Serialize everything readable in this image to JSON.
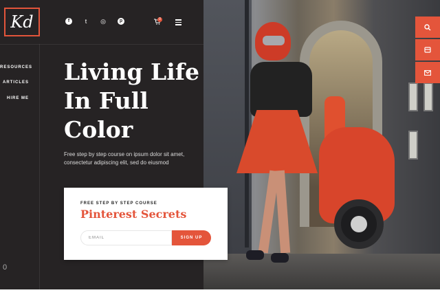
{
  "logo": {
    "text": "Kd"
  },
  "social": [
    {
      "icon": "facebook-icon",
      "glyph": "f"
    },
    {
      "icon": "twitter-icon",
      "glyph": "t"
    },
    {
      "icon": "instagram-icon",
      "glyph": "◎"
    },
    {
      "icon": "pinterest-icon",
      "glyph": "p"
    }
  ],
  "cart": {
    "icon": "cart-icon",
    "badge": "0"
  },
  "nav": {
    "items": [
      "RESOURCES",
      "ARTICLES",
      "HIRE ME"
    ]
  },
  "hero": {
    "title_line1": "Living Life",
    "title_line2": "In Full",
    "title_line3": "Color",
    "text": "Free step by step course on ipsum dolor sit amet, consectetur adipiscing elit, sed do eiusmod"
  },
  "card": {
    "kicker": "FREE STEP BY STEP COURSE",
    "title": "Pinterest Secrets",
    "email_placeholder": "EMAIL",
    "signup_label": "SIGN UP"
  },
  "scroll": {
    "number": "0"
  },
  "side_buttons": [
    "search-icon",
    "card-icon",
    "mail-icon"
  ],
  "colors": {
    "accent": "#e4553b",
    "panel": "#262324"
  }
}
